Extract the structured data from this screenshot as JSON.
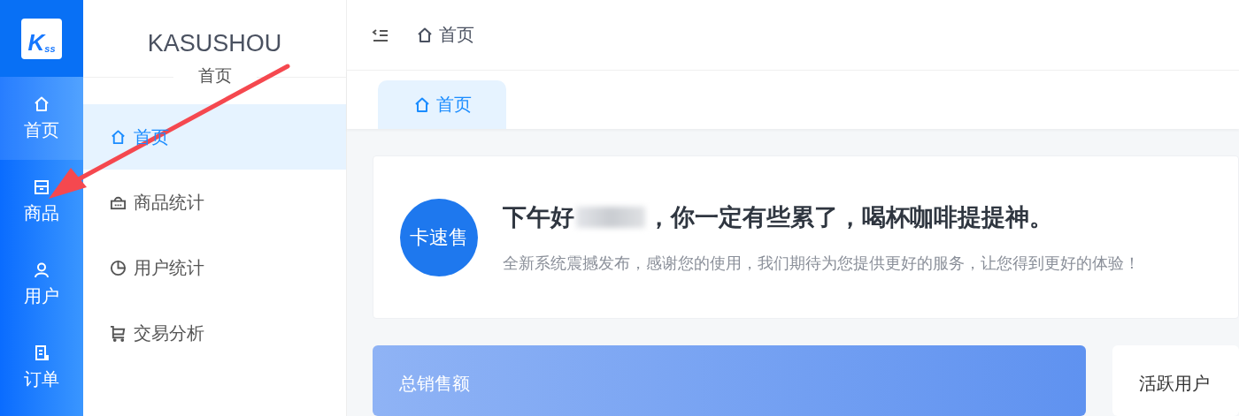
{
  "logo": {
    "letter": "K",
    "sub": "ss"
  },
  "rail": [
    {
      "label": "首页",
      "selected": true
    },
    {
      "label": "商品",
      "selected": false
    },
    {
      "label": "用户",
      "selected": false
    },
    {
      "label": "订单",
      "selected": false
    }
  ],
  "submenu": {
    "title": "KASUSHOU",
    "subtitle": "首页",
    "items": [
      {
        "label": "首页",
        "selected": true
      },
      {
        "label": "商品统计",
        "selected": false
      },
      {
        "label": "用户统计",
        "selected": false
      },
      {
        "label": "交易分析",
        "selected": false
      }
    ]
  },
  "breadcrumb": {
    "label": "首页"
  },
  "tabs": [
    {
      "label": "首页",
      "selected": true
    }
  ],
  "greeting": {
    "avatar_text": "卡速售",
    "prefix": "下午好",
    "suffix": "，你一定有些累了，喝杯咖啡提提神。",
    "message": "全新系统震撼发布，感谢您的使用，我们期待为您提供更好的服务，让您得到更好的体验！"
  },
  "stats": [
    {
      "title": "总销售额",
      "kind": "gradient"
    },
    {
      "title": "活跃用户",
      "kind": "plain"
    }
  ]
}
